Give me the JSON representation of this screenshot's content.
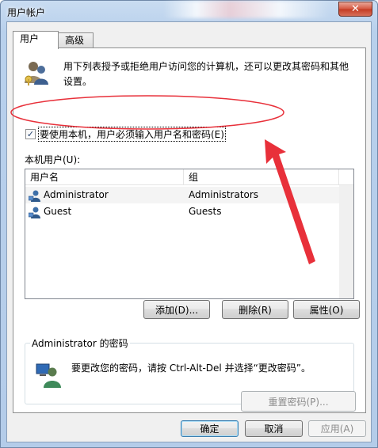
{
  "window": {
    "title": "用户帐户",
    "close": "✕"
  },
  "tabs": [
    {
      "label": "用户"
    },
    {
      "label": "高级"
    }
  ],
  "description": "用下列表授予或拒绝用户访问您的计算机，还可以更改其密码和其他设置。",
  "checkbox": {
    "label": "要使用本机，用户必须输入用户名和密码(E)",
    "checked": true,
    "mark": "✓"
  },
  "local_users_label": "本机用户(U):",
  "table": {
    "columns": [
      "用户名",
      "组"
    ],
    "rows": [
      {
        "name": "Administrator",
        "group": "Administrators"
      },
      {
        "name": "Guest",
        "group": "Guests"
      }
    ]
  },
  "buttons": {
    "add": "添加(D)...",
    "remove": "删除(R)",
    "properties": "属性(O)"
  },
  "password_group": {
    "title": "Administrator 的密码",
    "text": "要更改您的密码，请按 Ctrl-Alt-Del 并选择“更改密码”。",
    "reset": "重置密码(P)..."
  },
  "footer": {
    "ok": "确定",
    "cancel": "取消",
    "apply": "应用(A)"
  },
  "colors": {
    "annotation": "#e8303a",
    "accent": "#3c7fb1"
  }
}
